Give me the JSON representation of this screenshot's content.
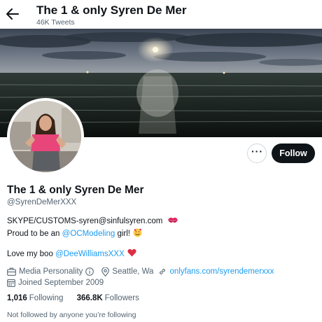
{
  "header": {
    "title": "The 1 & only Syren De Mer",
    "tweet_count": "46K Tweets"
  },
  "profile": {
    "display_name": "The 1 & only Syren De Mer",
    "handle": "@SyrenDeMerXXX",
    "follow_label": "Follow",
    "more_label": "···"
  },
  "bio": {
    "line1": "SKYPE/CUSTOMS-syren@sinfulsyren.com",
    "line2_prefix": "Proud to be an",
    "line2_mention": "@OCModeling",
    "line2_suffix": "girl!",
    "line3_prefix": "Love my boo",
    "line3_mention": "@DeeWilliamsXXX",
    "emojis": [
      "kiss-mark-icon",
      "smiling-face-with-hearts-icon",
      "red-heart-icon"
    ]
  },
  "meta": {
    "category": "Media Personality",
    "location": "Seattle, Wa",
    "website": "onlyfans.com/syrendemerxxx",
    "joined": "Joined September 2009"
  },
  "stats": {
    "following_count": "1,016",
    "following_label": "Following",
    "followers_count": "366.8K",
    "followers_label": "Followers"
  },
  "followed_by": "Not followed by anyone you’re following",
  "colors": {
    "accent": "#1d9bf0",
    "text": "#0f1419",
    "secondary": "#536471",
    "button": "#0f1419"
  }
}
